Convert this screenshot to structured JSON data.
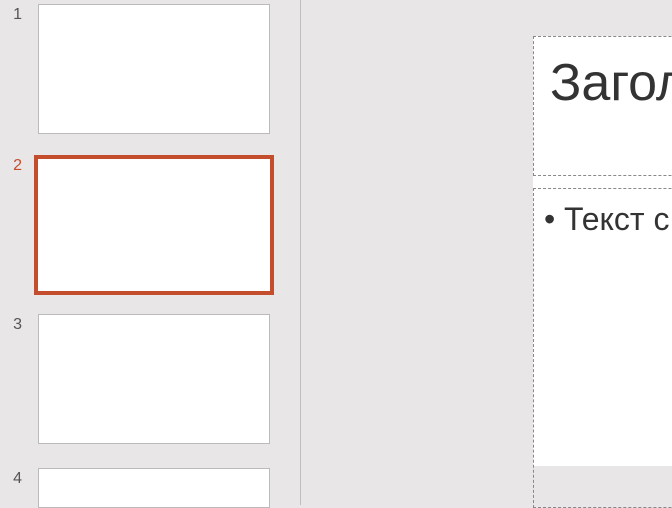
{
  "thumbnails": {
    "items": [
      {
        "number": "1",
        "selected": false
      },
      {
        "number": "2",
        "selected": true
      },
      {
        "number": "3",
        "selected": false
      },
      {
        "number": "4",
        "selected": false
      }
    ]
  },
  "slide": {
    "title_placeholder": "Загол",
    "content_placeholder": "Текст с"
  }
}
